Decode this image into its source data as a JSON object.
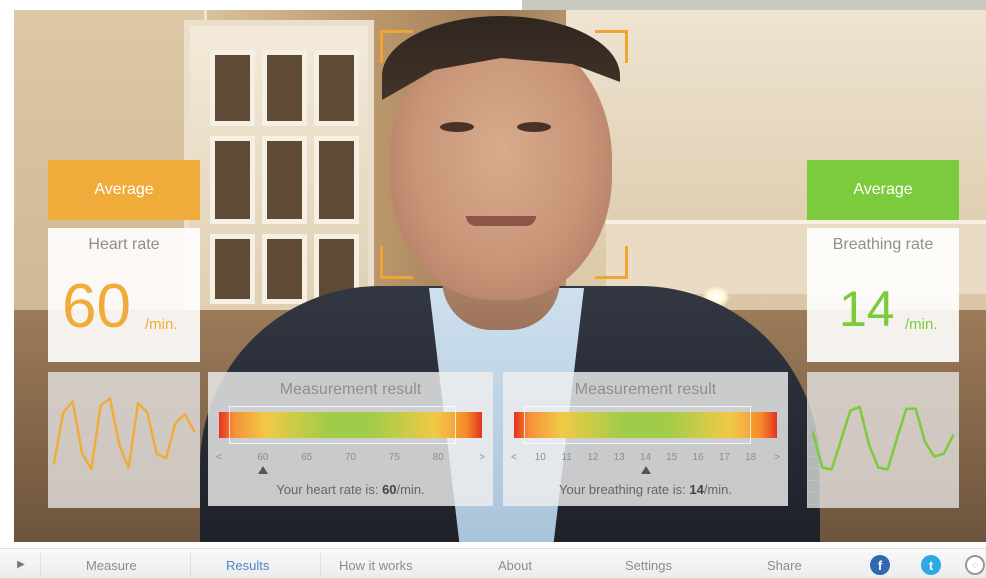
{
  "left_panel": {
    "tag": "Average",
    "label": "Heart rate",
    "value": "60",
    "unit": "/min.",
    "wave_values": [
      0.25,
      0.8,
      0.92,
      0.36,
      0.18,
      0.88,
      0.95,
      0.45,
      0.2,
      0.9,
      0.8,
      0.35,
      0.3,
      0.68,
      0.78,
      0.6
    ]
  },
  "right_panel": {
    "tag": "Average",
    "label": "Breathing rate",
    "value": "14",
    "unit": "/min.",
    "wave_values": [
      0.58,
      0.2,
      0.18,
      0.5,
      0.82,
      0.86,
      0.45,
      0.2,
      0.18,
      0.52,
      0.84,
      0.84,
      0.48,
      0.32,
      0.35,
      0.55
    ]
  },
  "heart_result": {
    "title": "Measurement result",
    "ticks": [
      "<",
      "60",
      "65",
      "70",
      "75",
      "80",
      ">"
    ],
    "marker_value": 60,
    "line_prefix": "Your heart rate is:",
    "line_value": "60",
    "line_unit": "/min."
  },
  "breath_result": {
    "title": "Measurement result",
    "ticks": [
      "<",
      "10",
      "11",
      "12",
      "13",
      "14",
      "15",
      "16",
      "17",
      "18",
      ">"
    ],
    "marker_value": 14,
    "line_prefix": "Your breathing rate is:",
    "line_value": "14",
    "line_unit": "/min."
  },
  "nav": {
    "items": [
      {
        "label": "Measure",
        "active": false
      },
      {
        "label": "Results",
        "active": true
      },
      {
        "label": "How it works",
        "active": false
      },
      {
        "label": "About",
        "active": false
      },
      {
        "label": "Settings",
        "active": false
      },
      {
        "label": "Share",
        "active": false
      }
    ]
  },
  "colors": {
    "orange": "#f0ac3b",
    "green": "#7ccb3c",
    "nav_active": "#4b86c9"
  }
}
